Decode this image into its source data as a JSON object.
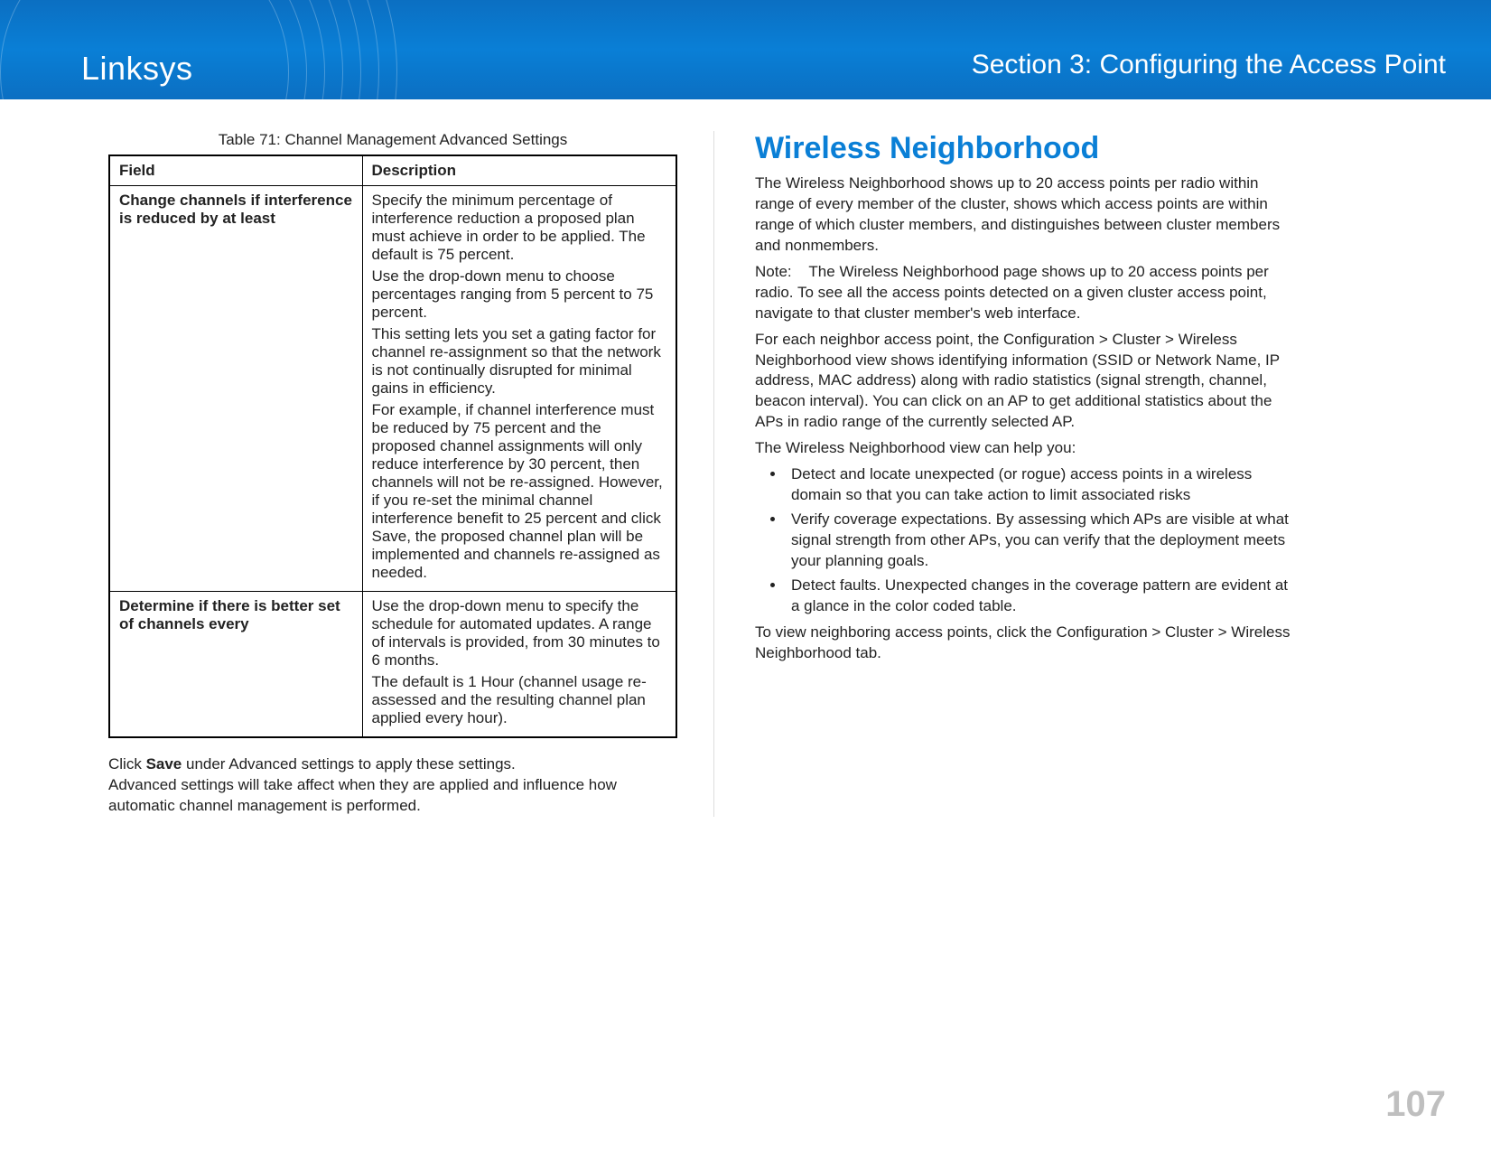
{
  "header": {
    "brand": "Linksys",
    "section": "Section 3:  Configuring the Access Point"
  },
  "left": {
    "table_caption": "Table 71: Channel Management Advanced Settings",
    "headers": {
      "field": "Field",
      "description": "Description"
    },
    "rows": [
      {
        "field": "Change channels if interference is reduced by at least",
        "desc": [
          "Specify the minimum percentage of interference reduction a proposed plan must achieve in order to be applied. The default is 75 percent.",
          "Use the drop-down menu to choose percentages ranging from 5 percent to 75 percent.",
          "This setting lets you set a gating factor for channel re-assignment so that the network is not continually disrupted for minimal gains in efficiency.",
          "For example, if channel interference must be reduced by 75 percent and the proposed channel assignments will only reduce interference by 30 percent, then channels will not be re-assigned. However, if you re-set the minimal channel interference benefit to 25 percent and click Save, the proposed channel plan will be implemented and channels re-assigned as needed."
        ]
      },
      {
        "field": "Determine if there is better set of channels every",
        "desc": [
          "Use the drop-down menu to specify the schedule for automated updates. A range of intervals is provided, from 30 minutes to 6 months.",
          "The default is 1 Hour (channel usage re-assessed and the resulting channel plan applied every hour)."
        ]
      }
    ],
    "after": {
      "click_prefix": "Click ",
      "save_word": "Save",
      "click_suffix": " under Advanced settings to apply these settings.",
      "line2": "Advanced settings will take affect when they are applied and influence how automatic channel management is performed."
    }
  },
  "right": {
    "heading": "Wireless Neighborhood",
    "p1": "The Wireless Neighborhood shows up to 20 access points per radio within range of every member of the cluster, shows which access points are within range of which cluster members, and distinguishes between cluster members and nonmembers.",
    "note_label": "Note:",
    "note_text": "The Wireless Neighborhood page shows up to 20 access points per radio. To see all the access points detected on a given cluster access point, navigate to that cluster member's web interface.",
    "p2": "For each neighbor access point, the Configuration > Cluster > Wireless Neighborhood view shows identifying information (SSID or Network Name, IP address, MAC address) along with radio statistics (signal strength, channel, beacon interval). You can click on an AP to get additional statistics about the APs in radio range of the currently selected AP.",
    "p3": "The Wireless Neighborhood view can help you:",
    "bullets": [
      "Detect and locate unexpected (or rogue) access points in a wireless domain so that you can take action to limit associated risks",
      "Verify coverage expectations. By assessing which APs are visible at what signal strength from other APs, you can verify that the deployment meets your planning goals.",
      "Detect faults. Unexpected changes in the coverage pattern are evident at a glance in the color coded table."
    ],
    "p4": "To view neighboring access points, click the Configuration > Cluster > Wireless Neighborhood tab."
  },
  "page_number": "107"
}
